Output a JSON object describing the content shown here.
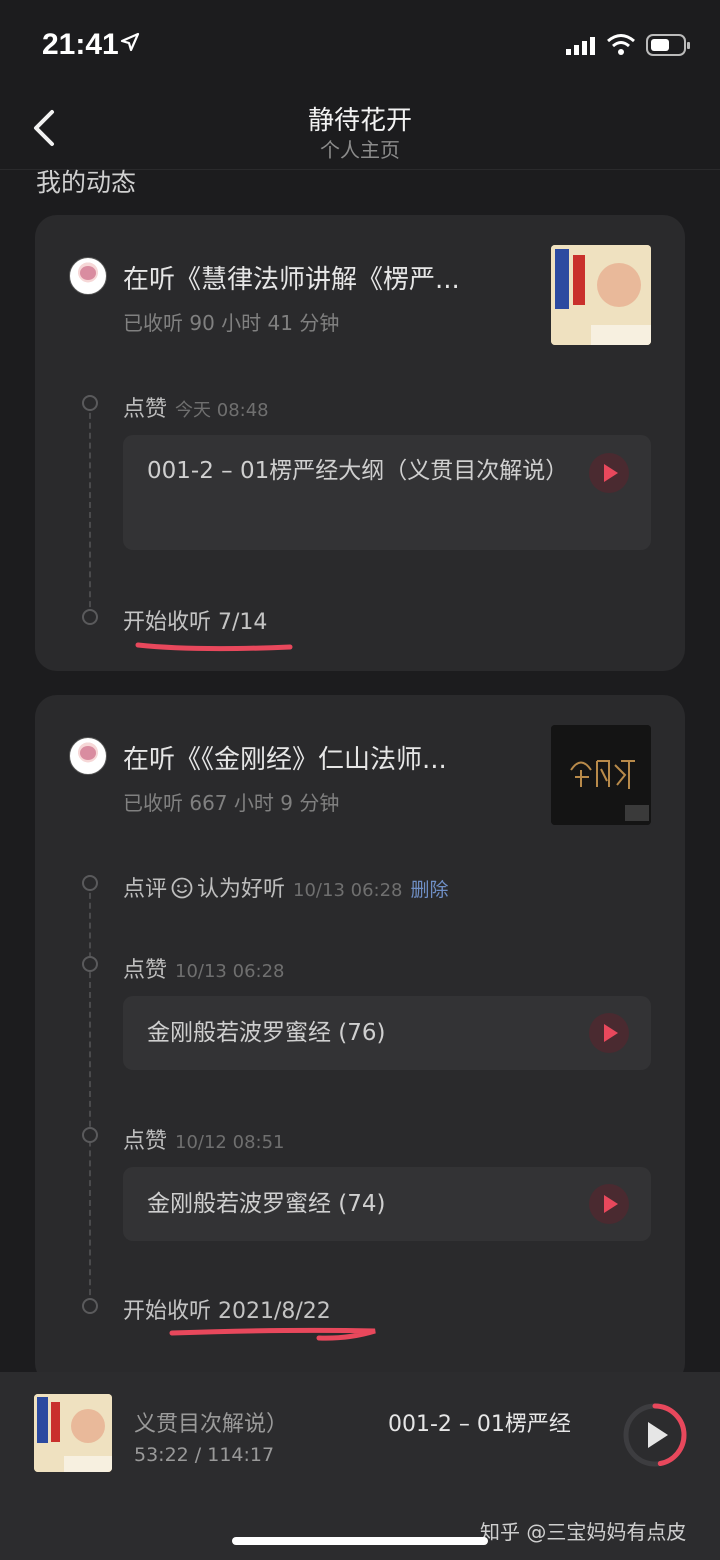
{
  "status": {
    "time": "21:41"
  },
  "nav": {
    "title": "静待花开",
    "subtitle": "个人主页"
  },
  "section": {
    "heading": "我的动态"
  },
  "cards": [
    {
      "title": "在听《慧律法师讲解《楞严...",
      "hours": "已收听 90 小时 41 分钟",
      "events": [
        {
          "label": "点赞",
          "time": "今天 08:48",
          "track": "001-2 – 01楞严经大纲（义贯目次解说）"
        }
      ],
      "start_label": "开始收听 7/14"
    },
    {
      "title": "在听《《金刚经》仁山法师...",
      "hours": "已收听 667 小时 9 分钟",
      "review": {
        "label_pre": "点评",
        "label_post": "认为好听",
        "time": "10/13 06:28",
        "delete": "删除"
      },
      "events": [
        {
          "label": "点赞",
          "time": "10/13 06:28",
          "track": "金刚般若波罗蜜经 (76)"
        },
        {
          "label": "点赞",
          "time": "10/12 08:51",
          "track": "金刚般若波罗蜜经 (74)"
        }
      ],
      "start_label": "开始收听 2021/8/22"
    }
  ],
  "player": {
    "track_prev": "义贯目次解说）",
    "track_next": "001-2 – 01楞严经",
    "time": "53:22 / 114:17",
    "progress": 0.47
  },
  "watermark": "知乎 @三宝妈妈有点皮",
  "colors": {
    "background": "#1c1c1e",
    "card": "#2a2a2c",
    "accent": "#e8485c",
    "underline": "#e8485c"
  }
}
